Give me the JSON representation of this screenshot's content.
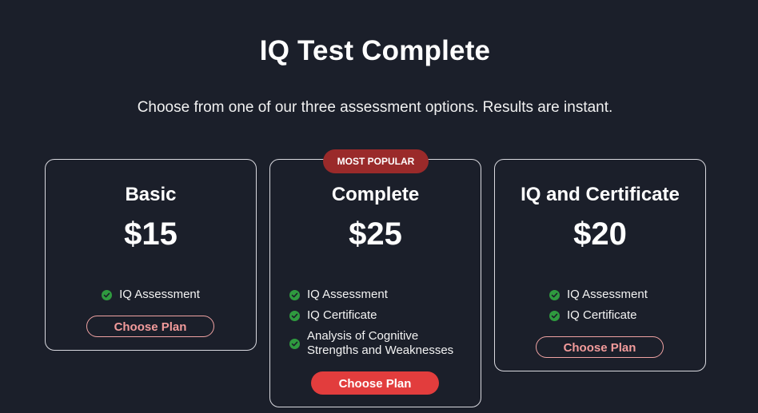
{
  "header": {
    "title": "IQ Test Complete",
    "subtitle": "Choose from one of our three assessment options. Results are instant."
  },
  "plans": [
    {
      "name": "Basic",
      "price": "$15",
      "features": [
        "IQ Assessment"
      ],
      "button_label": "Choose Plan",
      "button_style": "outline"
    },
    {
      "badge": "MOST POPULAR",
      "name": "Complete",
      "price": "$25",
      "features": [
        "IQ Assessment",
        "IQ Certificate",
        "Analysis of Cognitive",
        "Strengths and Weaknesses"
      ],
      "button_label": "Choose Plan",
      "button_style": "solid"
    },
    {
      "name": "IQ and Certificate",
      "price": "$20",
      "features": [
        "IQ Assessment",
        "IQ Certificate"
      ],
      "button_label": "Choose Plan",
      "button_style": "outline"
    }
  ],
  "colors": {
    "background": "#1b1f2a",
    "card_border": "#d9d9df",
    "accent_red": "#e23d3d",
    "badge_red": "#9a2a2a",
    "outline_pink": "#f0a3a3",
    "check_green": "#2f9a3f"
  },
  "icons": {
    "feature_bullet": "check-circle-icon"
  }
}
